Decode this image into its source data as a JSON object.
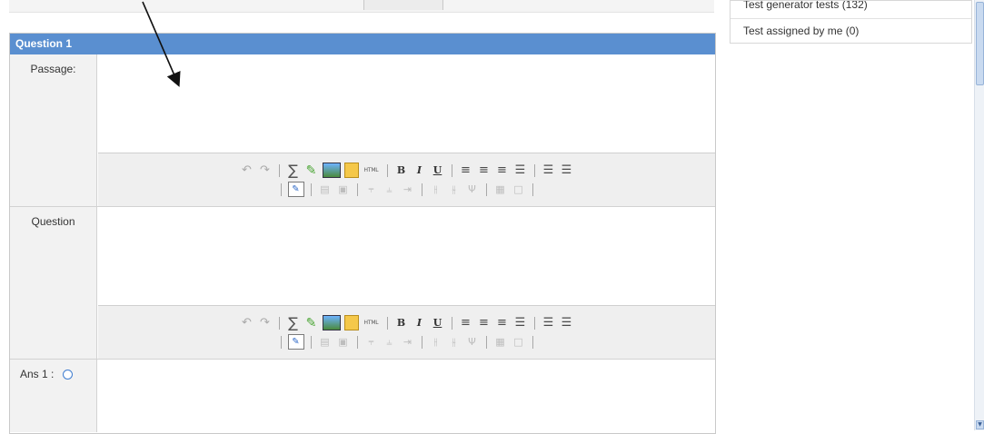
{
  "side_panel": {
    "items": [
      {
        "label": "Test generator tests (132)"
      },
      {
        "label": "Test assigned by me (0)"
      }
    ]
  },
  "question": {
    "header": "Question 1",
    "rows": [
      {
        "label": "Passage:"
      },
      {
        "label": "Question"
      },
      {
        "label": "Ans 1 :"
      }
    ],
    "toolbar_icons": [
      "undo-icon",
      "redo-icon",
      "sigma-icon",
      "pencil-icon",
      "image-icon",
      "paste-icon",
      "html-icon",
      "bold-icon",
      "italic-icon",
      "underline-icon",
      "align-left-icon",
      "align-center-icon",
      "align-right-icon",
      "justify-icon",
      "bullet-list-icon",
      "numbered-list-icon",
      "edit-table-icon",
      "table-icon",
      "table-props-icon",
      "row-before-icon",
      "row-after-icon",
      "delete-row-icon",
      "col-before-icon",
      "col-after-icon",
      "delete-col-icon",
      "merge-cells-icon",
      "split-cells-icon"
    ],
    "html_glyph": "HTML",
    "bold_glyph": "B",
    "italic_glyph": "I",
    "underline_glyph": "U"
  },
  "colors": {
    "header_bg": "#5a8fd0",
    "label_bg": "#f2f2f2",
    "toolbar_bg": "#efefef"
  }
}
